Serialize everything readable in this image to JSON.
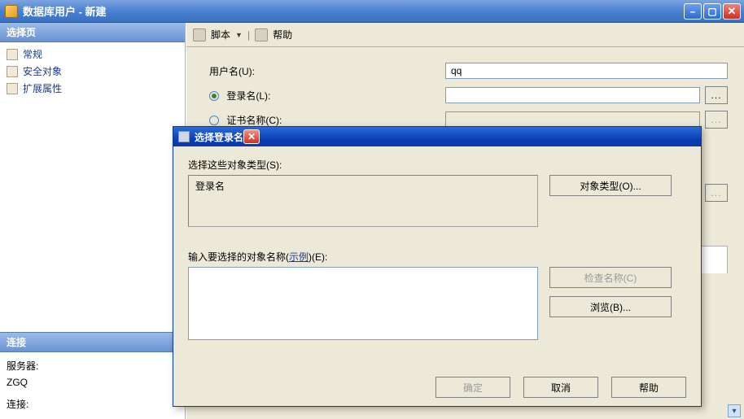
{
  "window": {
    "title": "数据库用户 - 新建"
  },
  "sidebar": {
    "select_head": "选择页",
    "items": [
      {
        "label": "常规"
      },
      {
        "label": "安全对象"
      },
      {
        "label": "扩展属性"
      }
    ],
    "conn_head": "连接",
    "server_label": "服务器:",
    "server_value": "ZGQ",
    "conn_label": "连接:"
  },
  "toolbar": {
    "script": "脚本",
    "help": "帮助"
  },
  "form": {
    "username_label": "用户名(U):",
    "username_value": "qq",
    "login_label": "登录名(L):",
    "login_value": "",
    "cert_label": "证书名称(C):",
    "browse": "..."
  },
  "dialog": {
    "title": "选择登录名",
    "select_types_label": "选择这些对象类型(S):",
    "obj_type_text": "登录名",
    "obj_type_btn": "对象类型(O)...",
    "enter_names_label_a": "输入要选择的对象名称(",
    "example_link": "示例",
    "enter_names_label_b": ")(E):",
    "names_value": "",
    "check_names_btn": "检查名称(C)",
    "browse_btn": "浏览(B)...",
    "ok": "确定",
    "cancel": "取消",
    "help": "帮助"
  }
}
